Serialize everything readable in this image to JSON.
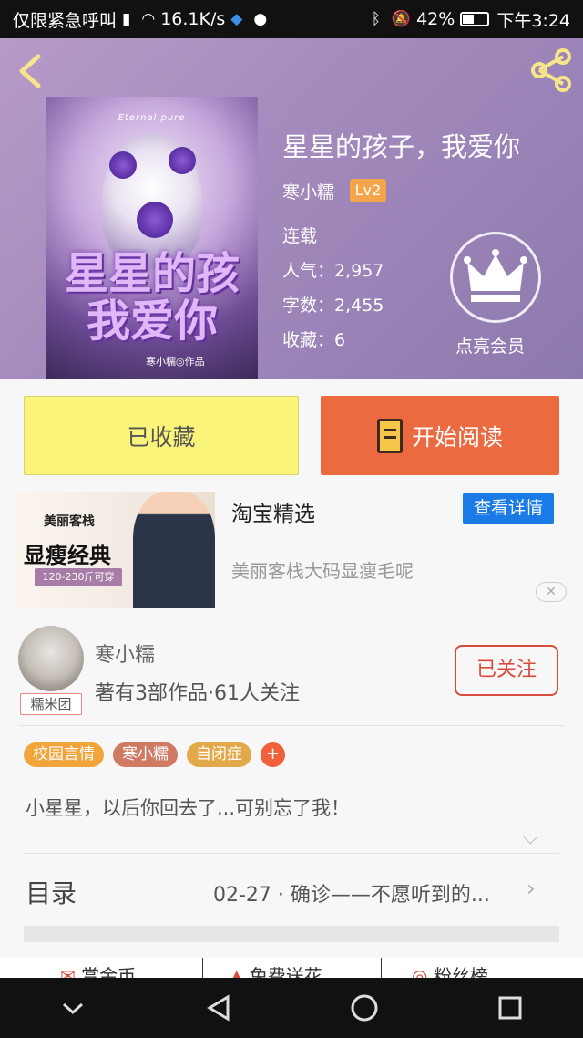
{
  "status_bar": {
    "carrier": "仅限紧急呼叫",
    "speed": "16.1K/s",
    "battery": "42%",
    "battery_level": 0.42,
    "time": "下午3:24"
  },
  "book": {
    "title": "星星的孩子，我爱你",
    "cover_english": "Eternal pure",
    "cover_title_line1": "星星的孩",
    "cover_title_line2": "我爱你",
    "cover_author": "寒小糯◎作品",
    "author": "寒小糯",
    "level": "Lv2",
    "status": "连载",
    "popularity": "人气：2,957",
    "word_count": "字数：2,455",
    "favorites": "收藏：6",
    "vip_label": "点亮会员"
  },
  "actions": {
    "favorite_label": "已收藏",
    "read_label": "开始阅读"
  },
  "ad": {
    "brand": "美丽客栈",
    "headline": "显瘦经典",
    "tag": "120-230斤可穿",
    "title": "淘宝精选",
    "button": "查看详情",
    "description": "美丽客栈大码显瘦毛呢",
    "close": "✕"
  },
  "author_card": {
    "name": "寒小糯",
    "badge": "糯米团",
    "stats": "著有3部作品·61人关注",
    "follow_label": "已关注"
  },
  "tags": [
    {
      "label": "校园言情",
      "color": "#f1a43a"
    },
    {
      "label": "寒小糯",
      "color": "#d07a64"
    },
    {
      "label": "自闭症",
      "color": "#e2a94a"
    },
    {
      "label": "+",
      "color": "#f0603a"
    }
  ],
  "intro": "小星星，以后你回去了...可别忘了我！",
  "toc": {
    "label": "目录",
    "latest": "02-27 · 确诊——不愿听到的..."
  },
  "bottom_actions": [
    "赏金币",
    "免费送花",
    "粉丝榜"
  ],
  "colors": {
    "accent_orange": "#ec6a3f",
    "favorite_yellow": "#fbf47a",
    "link_blue": "#1b7be6",
    "follow_red": "#d94b3a",
    "level_badge": "#f4a44a"
  }
}
